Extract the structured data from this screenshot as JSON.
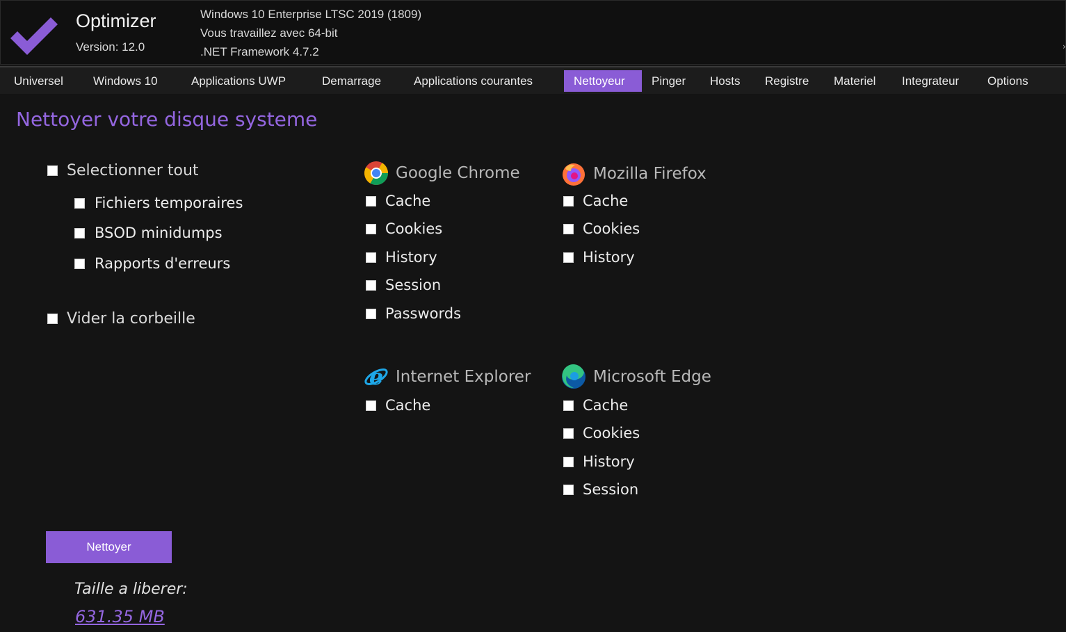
{
  "app": {
    "title": "Optimizer",
    "version": "Version: 12.0",
    "sysinfo": [
      "Windows 10 Enterprise LTSC 2019 (1809)",
      "Vous travaillez avec 64-bit",
      ".NET Framework 4.7.2"
    ],
    "accent_color": "#8a5cd6"
  },
  "tabs": [
    {
      "label": "Universel"
    },
    {
      "label": "Windows 10"
    },
    {
      "label": "Applications UWP"
    },
    {
      "label": "Demarrage"
    },
    {
      "label": "Applications courantes"
    },
    {
      "label": "Nettoyeur",
      "active": true
    },
    {
      "label": "Pinger"
    },
    {
      "label": "Hosts"
    },
    {
      "label": "Registre"
    },
    {
      "label": "Materiel"
    },
    {
      "label": "Integrateur"
    },
    {
      "label": "Options"
    }
  ],
  "cleaner": {
    "title": "Nettoyer votre disque systeme",
    "select_all": "Selectionner tout",
    "system_items": [
      "Fichiers temporaires",
      "BSOD minidumps",
      "Rapports d'erreurs"
    ],
    "empty_recycle_bin": "Vider la corbeille",
    "browsers": {
      "chrome": {
        "name": "Google Chrome",
        "icon": "chrome-icon",
        "items": [
          "Cache",
          "Cookies",
          "History",
          "Session",
          "Passwords"
        ]
      },
      "firefox": {
        "name": "Mozilla Firefox",
        "icon": "firefox-icon",
        "items": [
          "Cache",
          "Cookies",
          "History"
        ]
      },
      "ie": {
        "name": "Internet Explorer",
        "icon": "internet-explorer-icon",
        "items": [
          "Cache"
        ]
      },
      "edge": {
        "name": "Microsoft Edge",
        "icon": "edge-icon",
        "items": [
          "Cache",
          "Cookies",
          "History",
          "Session"
        ]
      }
    },
    "clean_button": "Nettoyer",
    "free_space_label": "Taille a liberer:",
    "free_space_value": "631.35 MB"
  }
}
